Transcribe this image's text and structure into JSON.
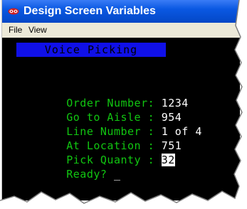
{
  "window": {
    "title": "Design Screen Variables"
  },
  "menu": {
    "items": [
      "File",
      "View"
    ]
  },
  "screen": {
    "header": "Voice Picking",
    "fields": [
      {
        "label": "Order Number: ",
        "value": "1234"
      },
      {
        "label": "Go to Aisle : ",
        "value": "954"
      },
      {
        "label": "Line Number : ",
        "value": "1 of 4"
      },
      {
        "label": "At Location : ",
        "value": "751"
      },
      {
        "label": "Pick Quanty : ",
        "value": "32"
      }
    ],
    "prompt": "Ready?",
    "cursor": "_"
  },
  "colors": {
    "title_bar": "#0a58e2",
    "terminal_bg": "#000000",
    "label_text": "#11c611",
    "value_text": "#ffffff",
    "header_bar": "#1010e8",
    "menubar_bg": "#ece9d8"
  },
  "icons": {
    "app_icon": "app-icon"
  }
}
